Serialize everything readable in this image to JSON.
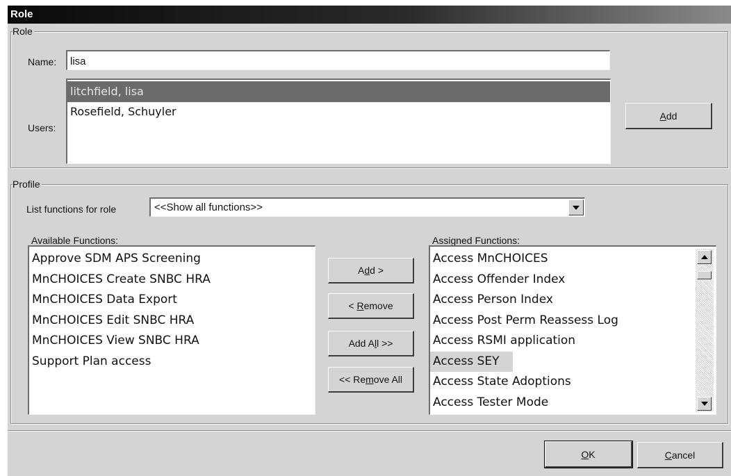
{
  "window": {
    "title": "Role"
  },
  "role_group": {
    "legend": "Role",
    "name_label": "Name:",
    "name_value": "lisa",
    "users_label": "Users:",
    "users": [
      "litchfield,  lisa",
      "Rosefield,  Schuyler"
    ],
    "add_button": {
      "pre": "",
      "u": "A",
      "post": "dd"
    }
  },
  "profile_group": {
    "legend": "Profile",
    "list_functions_label": "List functions for role",
    "list_functions_value": "<<Show all functions>>",
    "available_label": "Available Functions:",
    "available": [
      "Approve SDM APS Screening",
      "MnCHOICES Create SNBC HRA",
      "MnCHOICES Data Export",
      "MnCHOICES Edit SNBC HRA",
      "MnCHOICES View SNBC HRA",
      "Support Plan access"
    ],
    "assigned_label": "Assigned Functions:",
    "assigned": [
      "Access MnCHOICES",
      "Access Offender Index",
      "Access Person Index",
      "Access Post Perm Reassess Log",
      "Access RSMI application",
      "Access SEY",
      "Access State Adoptions",
      "Access Tester Mode"
    ],
    "btn_add": {
      "pre": "A",
      "u": "d",
      "post": "d >"
    },
    "btn_remove": {
      "pre": "< ",
      "u": "R",
      "post": "emove"
    },
    "btn_add_all": {
      "pre": "Add A",
      "u": "l",
      "post": "l >>"
    },
    "btn_remove_all": {
      "pre": "<< Re",
      "u": "m",
      "post": "ove All"
    }
  },
  "footer": {
    "ok": {
      "pre": "",
      "u": "O",
      "post": "K"
    },
    "cancel": {
      "pre": "",
      "u": "C",
      "post": "ancel"
    }
  },
  "colors": {
    "selection": "#6b6b6b",
    "highlight_item": "#d4d4d4",
    "face": "#d4d4d4"
  }
}
